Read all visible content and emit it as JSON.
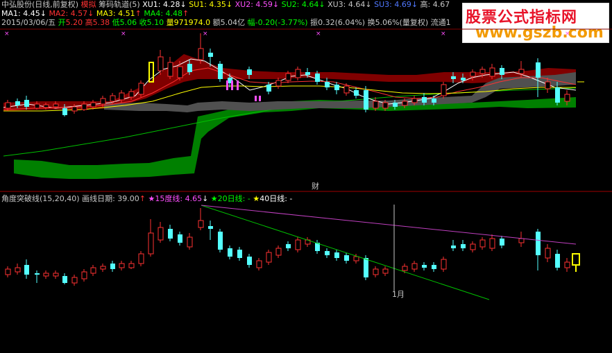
{
  "header": {
    "stock_name": "中弘股份(日线,前复权)",
    "mode_tag": "模拟",
    "indicator_name": "筹码轨道(5)",
    "xu1": "XU1: 4.28",
    "su1": "SU1: 4.35",
    "xu2": "XU2: 4.59",
    "su2": "SU2: 4.64",
    "xu3": "XU3: 4.64",
    "su3": "SU3: 4.69",
    "high_label": "高: 4.67",
    "ma1": "MA1: 4.45",
    "ma2": "MA2: 4.57",
    "ma3": "MA3: 4.51",
    "ma4": "MA4: 4.48",
    "date": "2015/03/06/五",
    "open_label": "开",
    "open_value": "5.20",
    "high2_label": "高",
    "high2_value": "5.38",
    "low_label": "低",
    "low_value": "5.06",
    "close_label": "收",
    "close_value": "5.10",
    "volume_label": "量",
    "volume_value": "971974.0",
    "amount": "额5.04亿",
    "change": "幅-0.20(-3.77%)",
    "amplitude": "振0.32(6.04%)",
    "turnover": "换5.06%(量复权)",
    "float_label": "流通1"
  },
  "sub_header": {
    "indicator_name": "角度突破线(15,20,40)",
    "date_label": "画线日期: 39.00",
    "line15": "15度线: 4.65",
    "line20": "20日线: -",
    "line40": "40日线: -"
  },
  "markers": {
    "cai": "财",
    "month": "1月"
  },
  "watermark": {
    "line1": "股票公式指标网",
    "line2": "www.gszb.com"
  },
  "colors": {
    "up": "#ff3232",
    "down": "#54ffff",
    "ma1": "#ffffff",
    "ma2": "#ff3232",
    "ma3": "#ffff00",
    "ma4": "#00ff00",
    "magenta": "#ff50ff"
  }
}
